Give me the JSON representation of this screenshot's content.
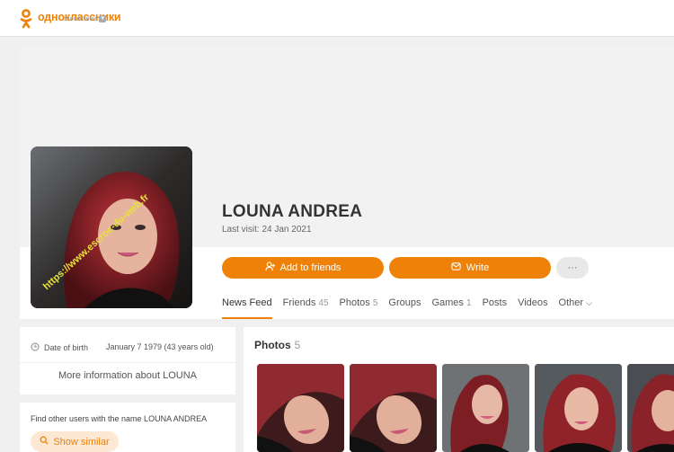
{
  "header": {
    "logo_name": "одноклассники",
    "logo_sub": "экосистема",
    "brand_color": "#ee8208"
  },
  "profile": {
    "name": "LOUNA ANDREA",
    "last_visit": "Last visit: 24 Jan 2021",
    "avatar_watermark": "https://www.escroc-du-web.fr",
    "add_friends_label": "Add to friends",
    "write_label": "Write",
    "more_label": "···",
    "tabs": [
      {
        "label": "News Feed",
        "count": ""
      },
      {
        "label": "Friends",
        "count": "45"
      },
      {
        "label": "Photos",
        "count": "5"
      },
      {
        "label": "Groups",
        "count": ""
      },
      {
        "label": "Games",
        "count": "1"
      },
      {
        "label": "Posts",
        "count": ""
      },
      {
        "label": "Videos",
        "count": ""
      },
      {
        "label": "Other",
        "count": ""
      }
    ]
  },
  "info": {
    "dob_label": "Date of birth",
    "dob_value": "January 7 1979 (43 years old)",
    "more_info": "More information about LOUNA"
  },
  "find": {
    "text": "Find other users with the name LOUNA ANDREA",
    "button": "Show similar"
  },
  "photos": {
    "title": "Photos",
    "count": "5"
  }
}
